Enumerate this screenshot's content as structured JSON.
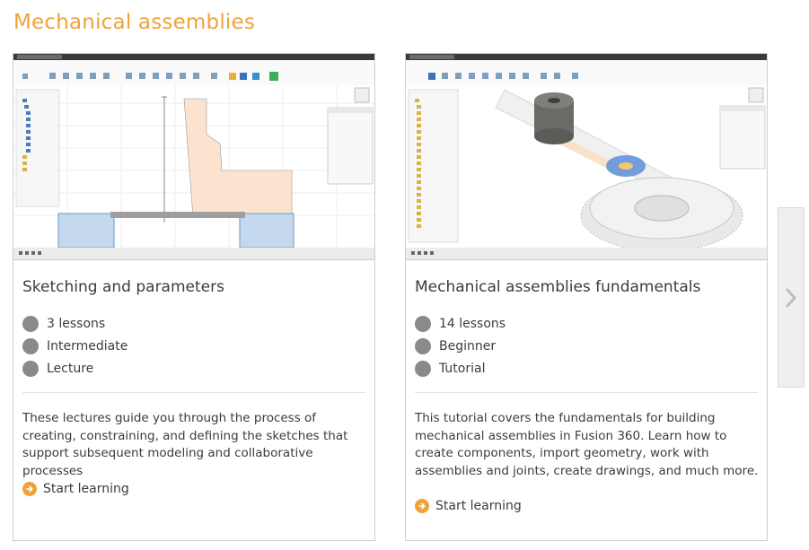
{
  "section": {
    "title": "Mechanical assemblies"
  },
  "courses": [
    {
      "title": "Sketching and parameters",
      "lessons": "3 lessons",
      "level": "Intermediate",
      "format": "Lecture",
      "description": "These lectures guide you through the process of creating, constraining, and defining the sketches that support subsequent modeling and collaborative processes",
      "cta": "Start learning",
      "thumbnail_icon": "fusion360-sketch-screenshot"
    },
    {
      "title": "Mechanical assemblies fundamentals",
      "lessons": "14 lessons",
      "level": "Beginner",
      "format": "Tutorial",
      "description": "This tutorial covers the fundamentals for building mechanical assemblies in Fusion 360. Learn how to create components, import geometry, work with assemblies and joints, create drawings, and much more.",
      "cta": "Start learning",
      "thumbnail_icon": "fusion360-assembly-screenshot"
    }
  ],
  "carousel": {
    "next_icon": "chevron-right-icon"
  },
  "colors": {
    "accent": "#f0a23a",
    "text": "#3c3c3c",
    "meta_dot": "#8a8a8a",
    "border": "#cfcfcf"
  }
}
